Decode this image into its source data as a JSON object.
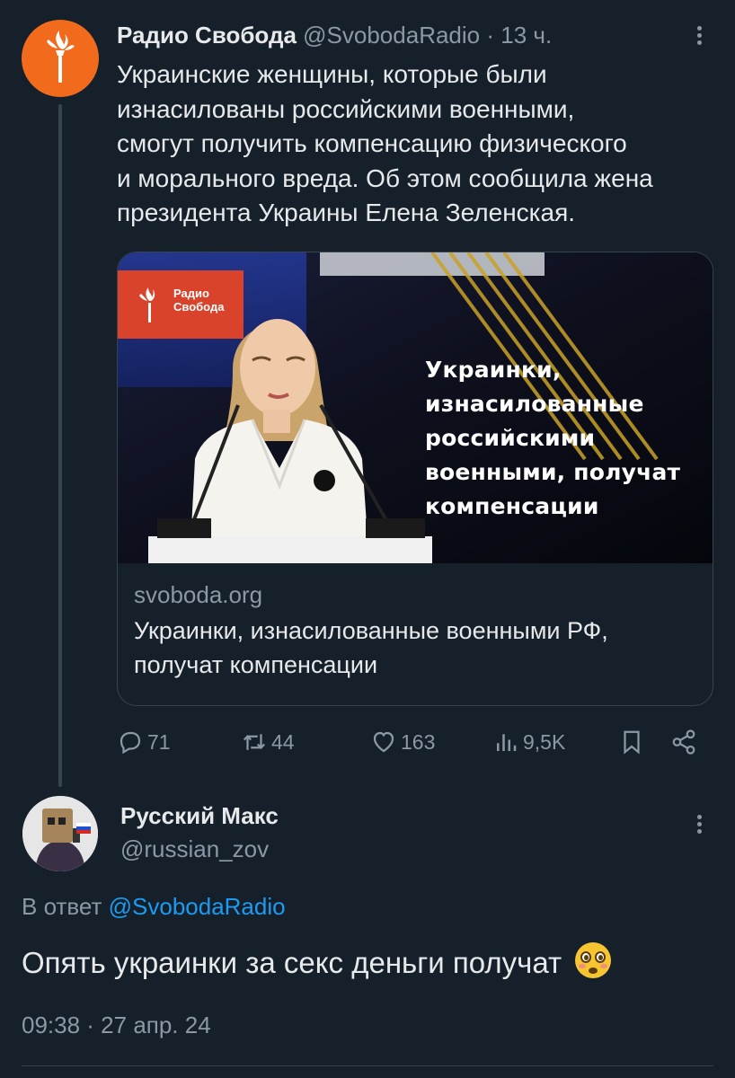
{
  "tweet": {
    "author_name": "Радио Свобода",
    "handle": "@SvobodaRadio",
    "separator": "·",
    "time": "13 ч.",
    "text": "Украинские женщины, которые были\nизнасилованы российскими военными,\nсмогут получить компенсацию физического\nи морального вреда. Об этом сообщила жена\nпрезидента Украины Елена Зеленская.",
    "avatar_icon": "radio-svoboda-torch-icon",
    "card": {
      "image_logo_text": "Радио\nСвобода",
      "image_overlay_text": "Украинки,\nизнасилованные\nроссийскими\nвоенными, получат\nкомпенсации",
      "domain": "svoboda.org",
      "title": "Украинки, изнасилованные военными РФ,\nполучат компенсации"
    },
    "actions": {
      "replies": "71",
      "retweets": "44",
      "likes": "163",
      "views": "9,5K"
    }
  },
  "reply": {
    "author_name": "Русский Макс",
    "handle": "@russian_zov",
    "reply_to_prefix": "В ответ",
    "reply_to_mention": "@SvobodaRadio",
    "text": "Опять украинки за секс деньги получат",
    "emoji": "flushed-face-emoji",
    "time": "09:38 · 27 апр. 24"
  },
  "colors": {
    "background": "#15202b",
    "text_primary": "#e7e9ea",
    "text_secondary": "#8b98a5",
    "link": "#1d9bf0",
    "avatar_orange": "#f26b1d",
    "logo_red": "#d9432b"
  }
}
